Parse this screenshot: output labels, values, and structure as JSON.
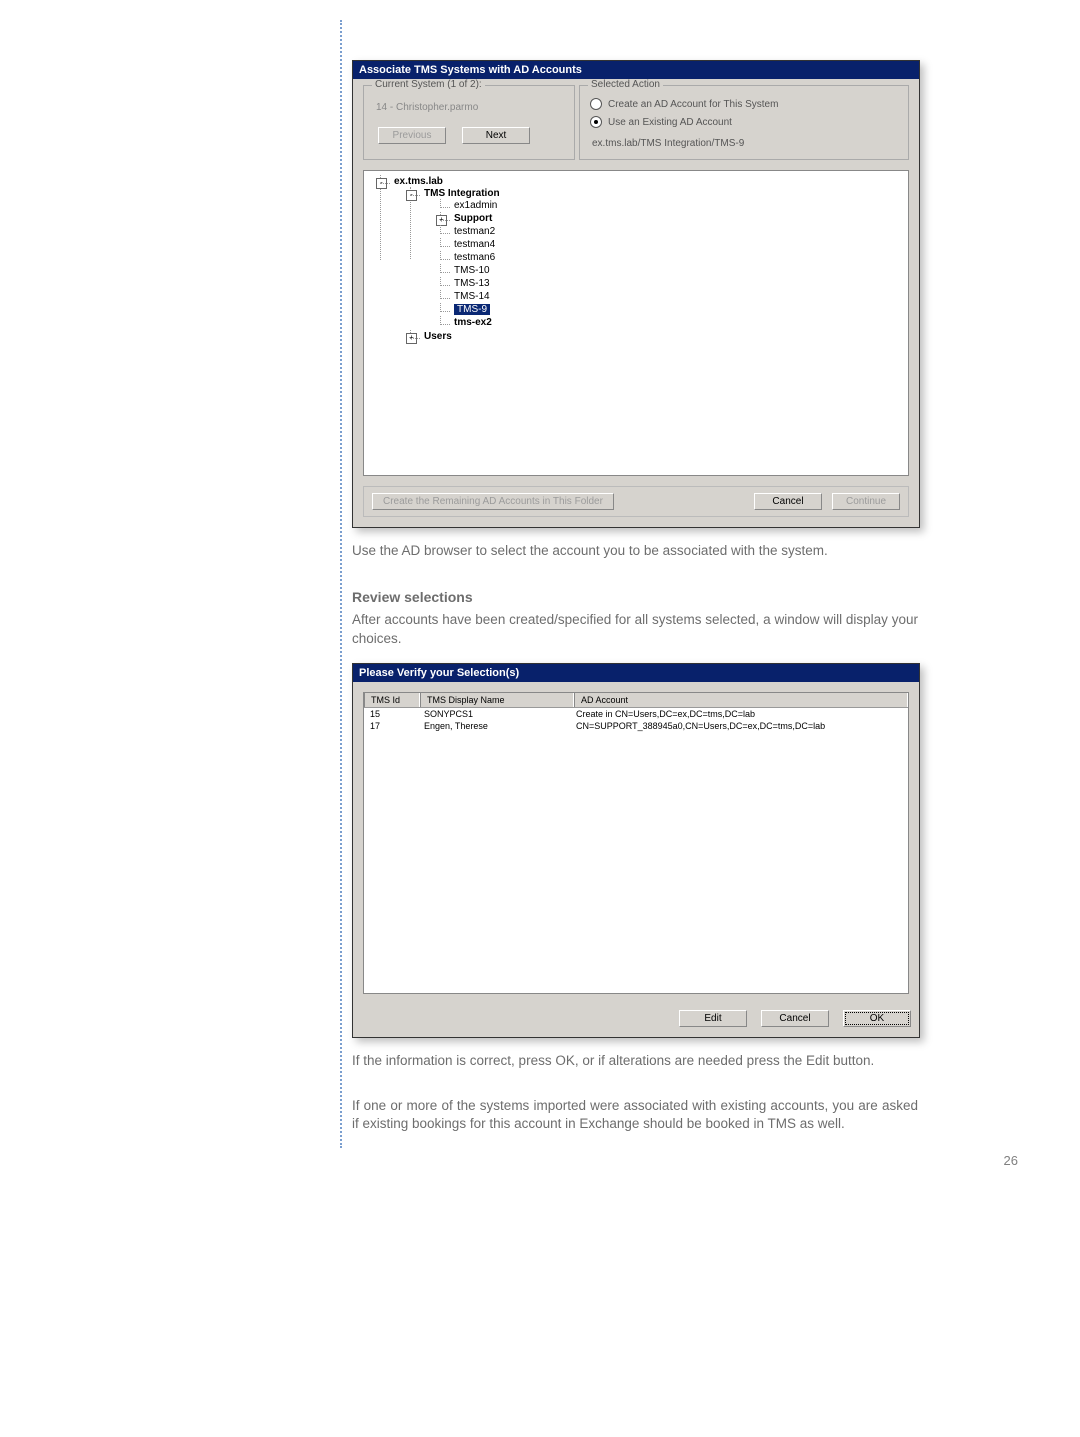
{
  "dialog1": {
    "title": "Associate TMS Systems with AD Accounts",
    "current_group_label": "Current System (1 of 2):",
    "current_system": "14 - Christopher.parmo",
    "prev_btn": "Previous",
    "next_btn": "Next",
    "action_group_label": "Selected Action",
    "radio_create": "Create an AD Account for This System",
    "radio_existing": "Use an Existing AD Account",
    "path_value": "ex.tms.lab/TMS Integration/TMS-9",
    "tree": {
      "root": "ex.tms.lab",
      "l1": "TMS Integration",
      "items": [
        "ex1admin",
        "Support",
        "testman2",
        "testman4",
        "testman6",
        "TMS-10",
        "TMS-13",
        "TMS-14",
        "TMS-9",
        "tms-ex2"
      ],
      "users": "Users"
    },
    "create_remaining_btn": "Create the Remaining AD Accounts in This Folder",
    "cancel_btn": "Cancel",
    "continue_btn": "Continue"
  },
  "para1": "Use the AD browser to select the account you to be associated with the system.",
  "heading1": "Review selections",
  "para2": "After accounts have been created/specified for all systems selected, a window will display your choices.",
  "dialog2": {
    "title": "Please Verify your Selection(s)",
    "headers": {
      "c1": "TMS Id",
      "c2": "TMS Display Name",
      "c3": "AD Account"
    },
    "rows": [
      {
        "id": "15",
        "name": "SONYPCS1",
        "acct": "Create in CN=Users,DC=ex,DC=tms,DC=lab"
      },
      {
        "id": "17",
        "name": "Engen, Therese",
        "acct": "CN=SUPPORT_388945a0,CN=Users,DC=ex,DC=tms,DC=lab"
      }
    ],
    "edit_btn": "Edit",
    "cancel_btn": "Cancel",
    "ok_btn": "OK"
  },
  "para3": "If the information is correct, press OK, or if alterations are needed press the Edit button.",
  "para4": "If one or more of the systems imported were associated with existing accounts, you are asked if existing bookings for this account in Exchange should be booked in TMS as well.",
  "page_number": "26"
}
